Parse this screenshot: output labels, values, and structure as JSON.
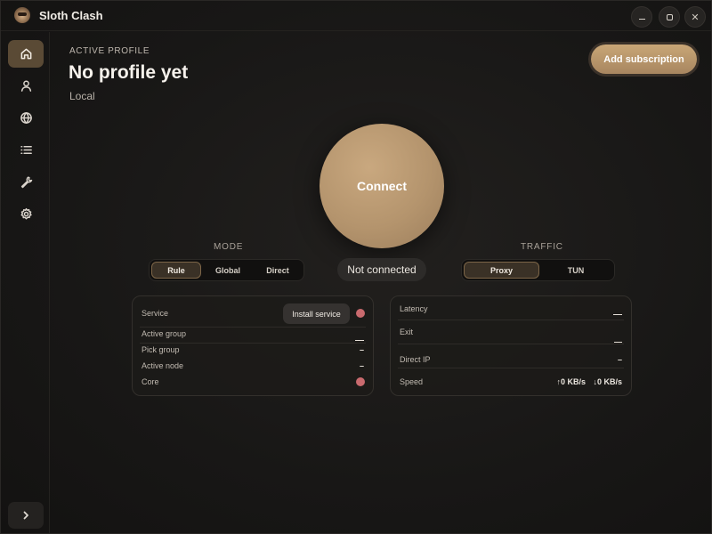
{
  "app": {
    "title": "Sloth Clash"
  },
  "window_controls": {
    "minimize_icon": "minimize-icon",
    "maximize_icon": "maximize-icon",
    "close_symbol": "✕"
  },
  "sidebar": {
    "items": [
      {
        "id": "home",
        "icon": "home-icon",
        "active": true
      },
      {
        "id": "profiles",
        "icon": "user-icon",
        "active": false
      },
      {
        "id": "proxies",
        "icon": "globe-icon",
        "active": false
      },
      {
        "id": "connections",
        "icon": "list-icon",
        "active": false
      },
      {
        "id": "tools",
        "icon": "wrench-icon",
        "active": false
      },
      {
        "id": "settings",
        "icon": "gear-icon",
        "active": false
      }
    ],
    "expand_icon": "chevron-right-icon"
  },
  "header": {
    "active_profile_label": "ACTIVE PROFILE",
    "profile_name": "No profile yet",
    "profile_source": "Local",
    "add_subscription_label": "Add subscription"
  },
  "connect": {
    "label": "Connect",
    "status": "Not connected"
  },
  "mode": {
    "label": "MODE",
    "options": [
      "Rule",
      "Global",
      "Direct"
    ],
    "selected": "Rule"
  },
  "traffic": {
    "label": "TRAFFIC",
    "options": [
      "Proxy",
      "TUN"
    ],
    "selected": "Proxy"
  },
  "info_left": {
    "service_label": "Service",
    "install_service_label": "Install service",
    "active_group_label": "Active group",
    "pick_group_label": "Pick group",
    "pick_group_value": "–",
    "active_node_label": "Active node",
    "active_node_value": "–",
    "core_label": "Core",
    "status_color": "#c96a6e"
  },
  "info_right": {
    "latency_label": "Latency",
    "exit_label": "Exit",
    "direct_ip_label": "Direct IP",
    "direct_ip_value": "–",
    "speed_label": "Speed",
    "speed_up": "↑0 KB/s",
    "speed_down": "↓0 KB/s"
  },
  "colors": {
    "accent": "#c4a175",
    "background": "#181716",
    "active_nav": "#5a4a35"
  }
}
